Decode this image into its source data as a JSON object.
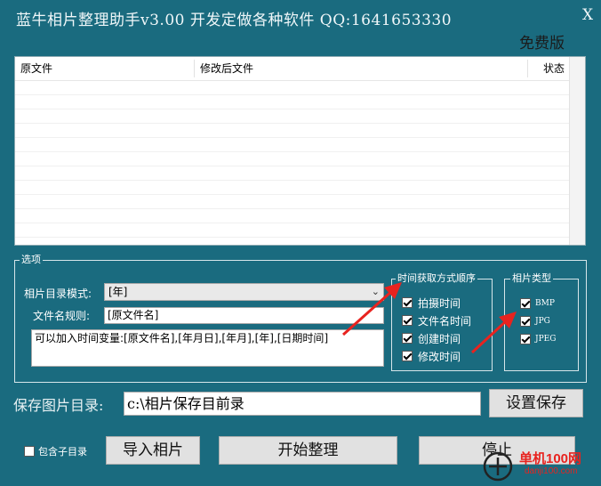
{
  "window": {
    "title": "蓝牛相片整理助手v3.00   开发定做各种软件   QQ:1641653330",
    "close_label": "X",
    "edition": "免费版"
  },
  "file_list": {
    "columns": [
      "原文件",
      "修改后文件",
      "状态"
    ],
    "rows": []
  },
  "options": {
    "group_label": "选项",
    "dir_mode_label": "相片目录模式:",
    "dir_mode_value": "[年]",
    "filename_rule_label": "文件名规则:",
    "filename_rule_value": "[原文件名]",
    "hint_text": "可以加入时间变量:[原文件名],[年月日],[年月],[年],[日期时间]"
  },
  "time_order": {
    "group_label": "时间获取方式顺序",
    "items": [
      {
        "label": "拍摄时间",
        "checked": true
      },
      {
        "label": "文件名时间",
        "checked": true
      },
      {
        "label": "创建时间",
        "checked": true
      },
      {
        "label": "修改时间",
        "checked": true
      }
    ]
  },
  "photo_types": {
    "group_label": "相片类型",
    "items": [
      {
        "label": "BMP",
        "checked": true
      },
      {
        "label": "JPG",
        "checked": true
      },
      {
        "label": "JPEG",
        "checked": true
      }
    ]
  },
  "save": {
    "label": "保存图片目录:",
    "path_value": "c:\\相片保存目前录",
    "set_button": "设置保存"
  },
  "bottom": {
    "include_subdir_label": "包含子目录",
    "include_subdir_checked": false,
    "import_button": "导入相片",
    "start_button": "开始整理",
    "stop_button": "停止"
  },
  "watermark": {
    "site_cn": "单机100网",
    "site_url": "danji100.com"
  },
  "colors": {
    "background": "#1a6b7f",
    "annotation_arrow": "#e8231f"
  }
}
